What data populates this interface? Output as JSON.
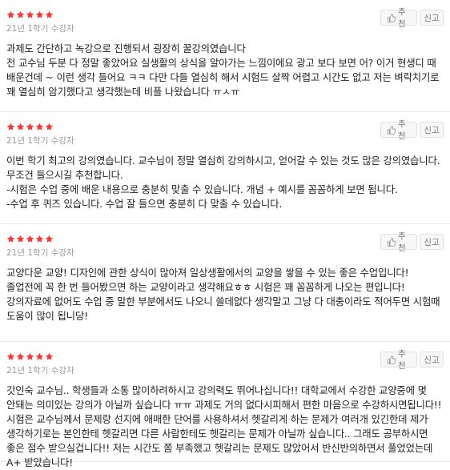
{
  "colors": {
    "star": "#ff3333",
    "meta": "#999999",
    "text": "#222222",
    "divider": "#e9e9e9"
  },
  "icons": {
    "rating": "star-icon",
    "recommend": "thumbs-up-icon"
  },
  "reviews": [
    {
      "rating": 5,
      "term": "21년 1학기 수강자",
      "recommend_label": "추천",
      "report_label": "신고",
      "text": "과제도 간단하고 녹강으로 진행되서 굉장히 꿀강의였습니다\n전 교수님 두분 다 정말 좋았어요 실생활의 상식을 알아가는 느낌이에요 광고 보다 보면 어? 이거 현생디 때 배운건데 ~ 이런 생각 들어요 ㅋㅋ 다만 다들 열심히 해서 시험드 살짝 어렵고 시간도 없고 저는 벼락치기로 꽤 열심히 암기했다고 생각했는데 비플 나왔습니다 ㅠㅅㅠ"
    },
    {
      "rating": 5,
      "term": "21년 1학기 수강자",
      "recommend_label": "추천",
      "report_label": "신고",
      "text": "이번 학기 최고의 강의였습니다. 교수님이 정말 열심히 강의하시고, 얻어갈 수 있는 것도 많은 강의였습니다. 무조건 들으시길 추천합니다.\n-시험은 수업 중에 배운 내용으로 충분히 맞출 수 있습니다. 개념 + 예시를 꼼꼼하게 보면 됩니다.\n-수업 후 퀴즈 있습니다. 수업 잘 들으면 충분히 다 맞출 수 있습니다."
    },
    {
      "rating": 5,
      "term": "21년 1학기 수강자",
      "recommend_label": "추천",
      "report_label": "신고",
      "text": "교양다운 교양! 디자인에 관한 상식이 많아져 일상생활에서의 교양을 쌓을 수 있는 좋은 수업입니다! 졸업전에 꼭 한 번 들어봤으면 하는 교양이라고 생각해요ㅎㅎ 시험은 꽤 꼼꼼하게 나오는 편입니다! 강의자료에 없어도 수업 중 말한 부분에서도 나오니 쓸데없다 생각말고 그냥 다 대충이라도 적어두면 시험때 도움이 많이 됩니당!"
    },
    {
      "rating": 5,
      "term": "21년 1학기 수강자",
      "recommend_label": "추천",
      "report_label": "신고",
      "text": "갓인숙 교수님.. 학생들과 소통 많이하려하시고 강의력도 뛰어나십니다!! 대학교에서 수강한 교양중에 몇 안돼는 의미있는 강의가 아닐까 싶습니다 ㅠㅠ 과제도 거의 없다시피해서 편한 마음으로 수강하시면됩니다!! 시험은 교수님께서 문제랑 선지에 애매한 단어를 사용하셔서 헷갈리게 하는 문제가 여러개 있긴한데 제가 생각하기로는 본인한테 헷갈리면 다른 사람한테도 헷갈리는 문제가 아닐까 싶습니다.. 그래도 공부하시면 좋은 점수 받으실겁니다!! 저는 시간도 쫌 부족했고 헷갈리는 문제도 많았어서 반신반의하면서 풀었었는데 A+ 받았습니다!"
    }
  ]
}
